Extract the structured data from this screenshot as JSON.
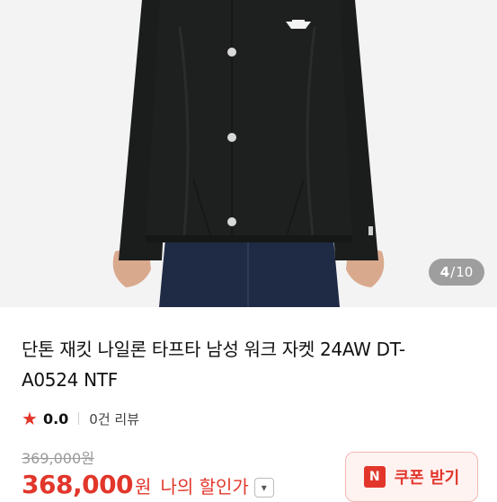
{
  "gallery": {
    "current": "4",
    "separator": "/",
    "total": "10"
  },
  "product": {
    "title_line1": "단톤 재킷 나일론 타프타 남성 워크 자켓 24AW DT-",
    "title_line2": "A0524 NTF",
    "rating": "0.0",
    "review_count": "0건 리뷰",
    "original_price": "369,000원",
    "price": "368,000",
    "price_unit": "원",
    "my_discount_label": "나의 할인가"
  },
  "coupon": {
    "badge": "N",
    "label": "쿠폰 받기"
  },
  "colors": {
    "accent": "#e2362b",
    "jacket": "#1b1d1c",
    "jeans": "#1f2b44"
  },
  "icons": {
    "star": "star-icon",
    "chevron": "chevron-down-icon",
    "coupon_badge": "n-badge-icon"
  }
}
